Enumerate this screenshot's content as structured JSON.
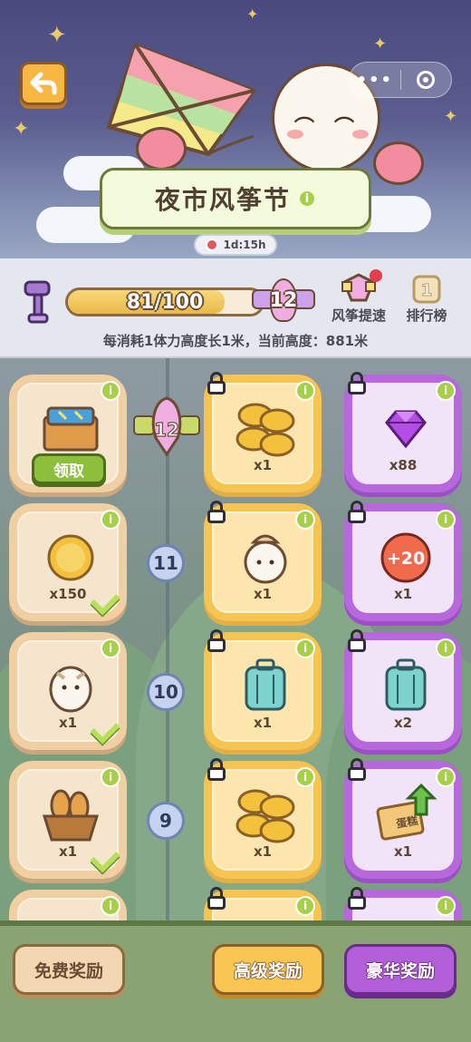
{
  "header": {
    "title": "夜市风筝节",
    "info": "i",
    "timer": "1d:15h",
    "capsule_dots": "•••"
  },
  "progress": {
    "current": 81,
    "max": 100,
    "label": "81/100",
    "kite_level": "12",
    "boost_label": "风筝提速",
    "rank_label": "排行榜",
    "rank_icon_num": "1",
    "hint": "每消耗1体力高度长1米，当前高度：881米"
  },
  "current_marker": "12",
  "rows": [
    {
      "level": "",
      "free": {
        "item": "chest-icon",
        "qty": "",
        "claim": "领取",
        "checked": false
      },
      "adv": {
        "item": "coin-stack-icon",
        "qty": "x1",
        "locked": true
      },
      "lux": {
        "item": "gem-icon",
        "qty": "x88",
        "locked": true
      }
    },
    {
      "level": "11",
      "free": {
        "item": "coin-icon",
        "qty": "x150",
        "checked": true
      },
      "adv": {
        "item": "owl-hat-icon",
        "qty": "x1",
        "locked": true
      },
      "lux": {
        "item": "energy-plus-icon",
        "qty": "x1",
        "badge": "+20",
        "locked": true
      }
    },
    {
      "level": "10",
      "free": {
        "item": "owl-icon",
        "qty": "x1",
        "checked": true
      },
      "adv": {
        "item": "suitcase-icon",
        "qty": "x1",
        "locked": true
      },
      "lux": {
        "item": "suitcase-icon",
        "qty": "x2",
        "locked": true
      }
    },
    {
      "level": "9",
      "free": {
        "item": "bread-basket-icon",
        "qty": "x1",
        "checked": true
      },
      "adv": {
        "item": "coin-stack-icon",
        "qty": "x1",
        "locked": true
      },
      "lux": {
        "item": "cake-ticket-icon",
        "qty": "x1",
        "ticket_text": "蛋糕",
        "locked": true
      }
    }
  ],
  "tabs": {
    "free": "免费奖励",
    "advanced": "高级奖励",
    "luxury": "豪华奖励"
  },
  "colors": {
    "free": "#f0d0a3",
    "advanced": "#f5c451",
    "luxury": "#b868dd",
    "info_green": "#a8cf4a"
  }
}
